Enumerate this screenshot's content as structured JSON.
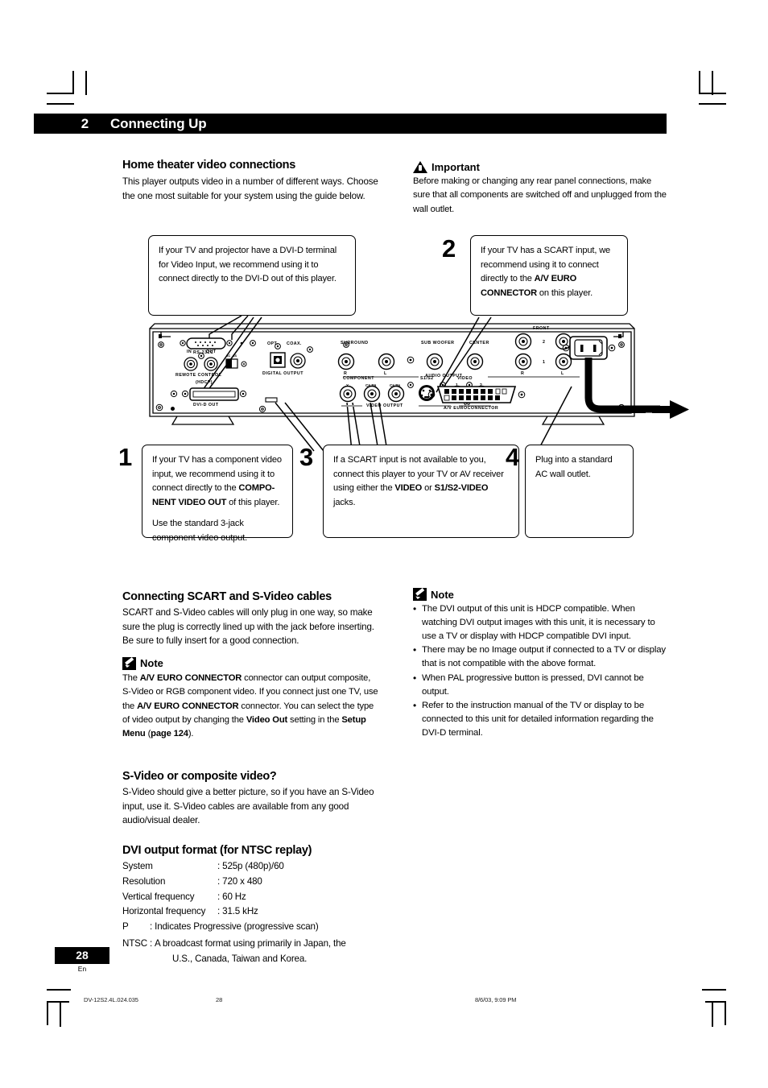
{
  "chapter": {
    "number": "2",
    "title": "Connecting Up"
  },
  "left_column": {
    "heading1": "Home theater video connections",
    "para1": "This player outputs video in a number of different ways. Choose the one most suitable for your system using the guide below.",
    "heading2": "Connecting SCART and S-Video cables",
    "para2": "SCART and S-Video cables will only plug in one way, so make sure the plug is correctly lined up with the jack before inserting. Be sure to fully insert for a good connection.",
    "note_label": "Note",
    "note_text_1": "The ",
    "note_bold_1": "A/V EURO CONNECTOR",
    "note_text_2": " connector can output composite, S-Video or RGB component video. If you connect just one TV, use the ",
    "note_bold_2": "A/V EURO CONNECTOR",
    "note_text_3": " connector. You can select the type of video output by changing the ",
    "note_bold_3": "Video Out",
    "note_text_4": " setting in the ",
    "note_bold_4": "Setup Menu",
    "note_text_5": " (",
    "note_bold_5": "page 124",
    "note_text_6": ").",
    "heading3": "S-Video or composite video?",
    "para3": "S-Video should give a better picture, so if you have an S-Video input, use it. S-Video cables are available from any good audio/visual dealer.",
    "heading4": "DVI output format (for NTSC replay)",
    "specs": [
      {
        "key": "System",
        "value": ": 525p (480p)/60"
      },
      {
        "key": "Resolution",
        "value": ": 720 x 480"
      },
      {
        "key": "Vertical frequency",
        "value": ": 60 Hz"
      },
      {
        "key": "Horizontal frequency",
        "value": ": 31.5 kHz"
      },
      {
        "key": "P",
        "value": ": Indicates Progressive (progressive scan)"
      }
    ],
    "ntsc_key": "NTSC :",
    "ntsc_value": "A broadcast format using primarily in Japan, the",
    "ntsc_value2": "U.S., Canada, Taiwan and Korea."
  },
  "right_column": {
    "important_label": "Important",
    "important_text": "Before making or changing any rear panel connections, make sure that all components are switched off and unplugged from the wall outlet.",
    "note_label": "Note",
    "note_bullets": [
      "The DVI output of this unit is HDCP compatible. When watching DVI output images with this unit, it is necessary to use a TV or display with HDCP compatible DVI input.",
      "There may be no Image output if connected to a TV or display that is not compatible with the above format.",
      "When PAL progressive button is pressed, DVI cannot be output.",
      "Refer to the instruction manual of the TV or display to be connected to this unit for detailed information regarding the DVI-D terminal."
    ]
  },
  "diagram": {
    "callout_dvi": {
      "line1": "If your TV and projector have a DVI-D",
      "line2": "terminal for Video Input, we recommend using",
      "line3": "it to connect directly to the DVI-D out of this",
      "line4": "player."
    },
    "callout_scart": {
      "number": "2",
      "text_a": "If your TV has a SCART input, we recommend using it to connect directly to the ",
      "bold_a": "A/V EURO CONNECTOR",
      "text_b": " on this player."
    },
    "callout_component": {
      "number": "1",
      "text_a": "If your TV has a component video input, we recommend using it to connect directly to the ",
      "bold_a": "COMPO-NENT VIDEO OUT",
      "text_b": " of this player.",
      "para2": "Use the standard 3-jack component video output."
    },
    "callout_video": {
      "number": "3",
      "text_a": "If a SCART input is not available to you, connect this player to your TV or AV receiver using either the ",
      "bold_a": "VIDEO",
      "text_b": " or ",
      "bold_b": "S1/S2-VIDEO",
      "text_c": " jacks."
    },
    "callout_power": {
      "number": "4",
      "text": "Plug into a standard AC wall outlet."
    },
    "panel_labels": {
      "rs232c": "RS-232C",
      "remote_in": "IN",
      "remote_out": "OUT",
      "remote_control": "REMOTE CONTROL",
      "hdcp": "(HDCP)",
      "dvi_d_out": "DVI-D OUT",
      "opt": "OPT.",
      "coax": "COAX.",
      "digital_output": "DIGITAL OUTPUT",
      "surround": "SURROUND",
      "sub_woofer": "SUB WOOFER",
      "center": "CENTER",
      "front": "FRONT",
      "audio_output": "AUDIO OUTPUT",
      "component": "COMPONENT",
      "s1s2": "S1/S2",
      "video": "VIDEO",
      "video_output": "VIDEO OUTPUT",
      "euroconnector": "A/V EUROCONNECTOR",
      "ch_r": "R",
      "ch_l": "L",
      "num1": "1",
      "num2": "2",
      "comp_y": "Y",
      "comp_cb": "Cʙ Pʙ",
      "comp_cr": "Cʀ Pʀ",
      "sw_sc": "SC",
      "sw_ss": "SS"
    }
  },
  "footer": {
    "page_number": "28",
    "language": "En",
    "print_file": "DV-12S2.4L.024.035",
    "print_page": "28",
    "print_date": "8/6/03, 9:09 PM"
  }
}
